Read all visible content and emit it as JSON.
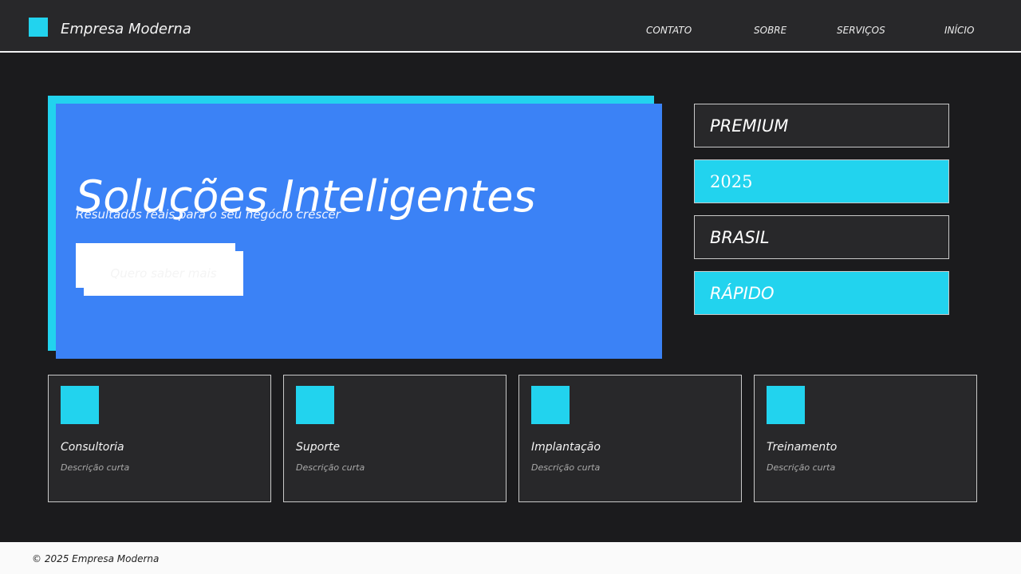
{
  "header": {
    "brand": "Empresa Moderna",
    "logo_icon": "square-logo-icon",
    "nav": [
      "CONTATO",
      "SOBRE",
      "SERVIÇOS",
      "INÍCIO"
    ]
  },
  "hero": {
    "title": "Soluções Inteligentes",
    "subtitle": "Resultados reais para o seu negócio crescer",
    "cta_label": "Quero saber mais"
  },
  "tags": [
    "PREMIUM",
    "2025",
    "BRASIL",
    "RÁPIDO"
  ],
  "cards": [
    {
      "title": "Consultoria",
      "desc": "Descrição curta"
    },
    {
      "title": "Suporte",
      "desc": "Descrição curta"
    },
    {
      "title": "Implantação",
      "desc": "Descrição curta"
    },
    {
      "title": "Treinamento",
      "desc": "Descrição curta"
    }
  ],
  "footer": {
    "text": "© 2025 Empresa Moderna"
  },
  "colors": {
    "accent": "#22d3ee",
    "primary": "#3b82f6",
    "background": "#1b1b1d",
    "surface": "#28282a",
    "footer": "#fafafa"
  }
}
